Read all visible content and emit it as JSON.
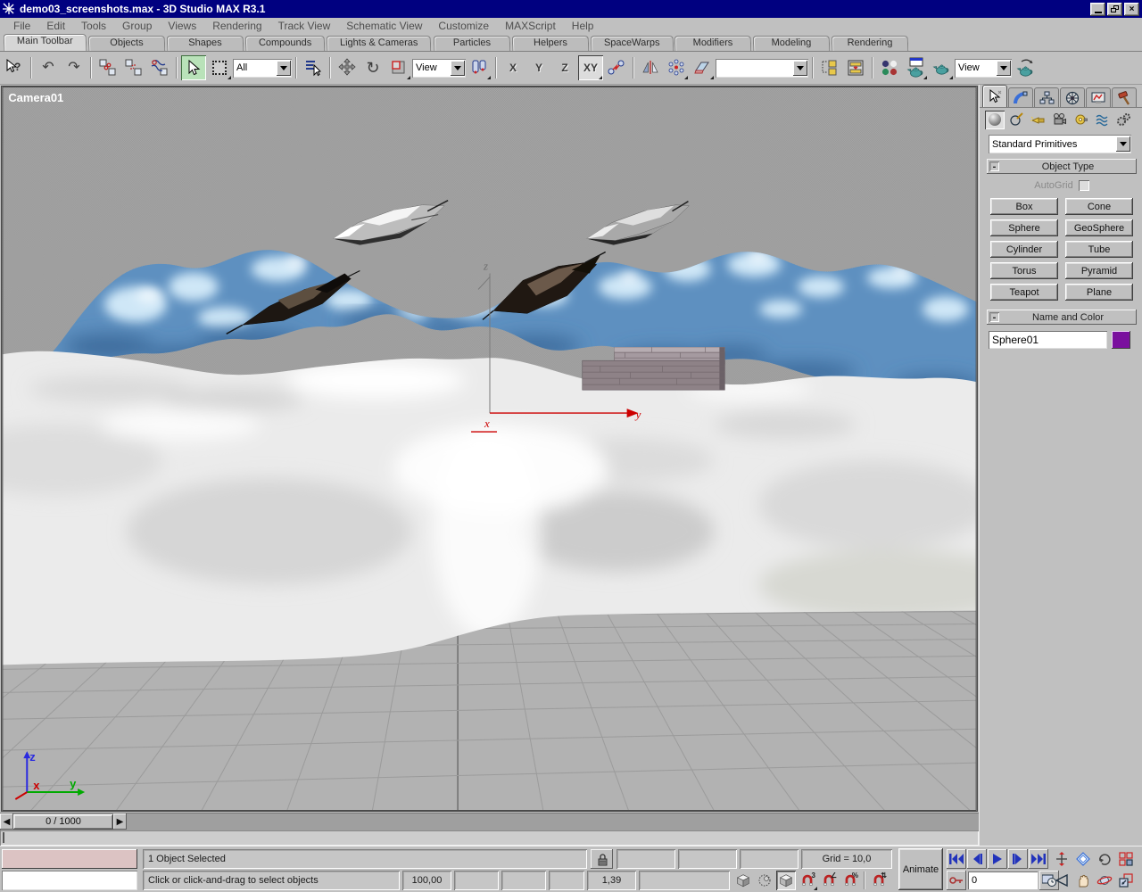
{
  "window": {
    "title": "demo03_screenshots.max - 3D Studio MAX R3.1",
    "controls": {
      "minimize": "minimize",
      "restore": "restore",
      "close": "×"
    }
  },
  "menu": {
    "items": [
      "File",
      "Edit",
      "Tools",
      "Group",
      "Views",
      "Rendering",
      "Track View",
      "Schematic View",
      "Customize",
      "MAXScript",
      "Help"
    ]
  },
  "tabs": {
    "active": "Main Toolbar",
    "items": [
      "Main Toolbar",
      "Objects",
      "Shapes",
      "Compounds",
      "Lights & Cameras",
      "Particles",
      "Helpers",
      "SpaceWarps",
      "Modifiers",
      "Modeling",
      "Rendering"
    ]
  },
  "toolbar": {
    "selection_filter": "All",
    "coord_system": "View",
    "named_selection": "",
    "render_type": "View",
    "axis_x": "X",
    "axis_y": "Y",
    "axis_z": "Z",
    "axis_xy": "XY",
    "icon_names": [
      "help-mode",
      "undo",
      "redo",
      "select-and-link",
      "unlink-selection",
      "bind-to-space-warp",
      "select-object",
      "rectangular-selection-region",
      "select-by-name",
      "select-and-move",
      "select-and-rotate",
      "select-and-scale",
      "use-pivot-point-center",
      "ik-toggle",
      "mirror",
      "array",
      "align",
      "open-track-view",
      "open-schematic-view",
      "material-editor",
      "render-scene",
      "quick-render",
      "render-last"
    ]
  },
  "viewport": {
    "label": "Camera01",
    "tripod": {
      "x": "x",
      "y": "y",
      "z": "z"
    },
    "world_axis": {
      "x": "x",
      "y": "y",
      "z": "z"
    }
  },
  "time": {
    "slider_label": "0 / 1000",
    "frame_field": "0"
  },
  "command_panel": {
    "tabs": [
      "create",
      "modify",
      "hierarchy",
      "motion",
      "display",
      "utilities"
    ],
    "categories": [
      "geometry",
      "shapes",
      "lights",
      "cameras",
      "helpers",
      "space-warps",
      "systems"
    ],
    "category_dropdown": "Standard Primitives",
    "object_type": {
      "title": "Object Type",
      "collapse": "-",
      "autogrid_label": "AutoGrid",
      "buttons": [
        "Box",
        "Cone",
        "Sphere",
        "GeoSphere",
        "Cylinder",
        "Tube",
        "Torus",
        "Pyramid",
        "Teapot",
        "Plane"
      ]
    },
    "name_and_color": {
      "title": "Name and Color",
      "collapse": "-",
      "object_name": "Sphere01",
      "color_swatch": "#7a0f9e"
    }
  },
  "status": {
    "selection_line": "1 Object Selected",
    "prompt_line": "Click or click-and-drag to select objects",
    "transform_value": "100,00",
    "time_value": "1,39",
    "grid_size": "Grid = 10,0",
    "animate_label": "Animate"
  },
  "colors": {
    "titlebar": "#000080",
    "active_select_highlight": "#b9e2b9",
    "mountain_blue": "#5e90c0",
    "viewport_sky": "#9d9d9d",
    "name_color_swatch": "#7a0f9e"
  }
}
